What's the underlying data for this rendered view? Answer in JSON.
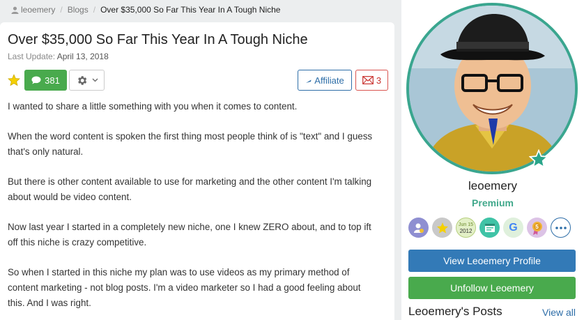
{
  "breadcrumb": {
    "user": "leoemery",
    "section": "Blogs",
    "current": "Over $35,000 So Far This Year In A Tough Niche"
  },
  "post": {
    "title": "Over $35,000 So Far This Year In A Tough Niche",
    "last_update_label": "Last Update:",
    "last_update_date": "April 13, 2018",
    "comment_count": "381",
    "affiliate_label": "Affiliate",
    "message_count": "3",
    "paragraphs": [
      "I wanted to share a little something with you when it comes to content.",
      "When the word content is spoken the first thing most people think of is \"text\" and I guess that's only natural.",
      "But there is other content available to use for marketing and the other content I'm talking about would be video content.",
      "Now last year I started in a completely new niche, one I knew ZERO about, and to top ift off this niche is crazy competitive.",
      "So when I started in this niche my plan was to use videos as my primary method of content marketing - not blog posts. I'm a video marketer so I had a good feeling about this. And I was right."
    ]
  },
  "icons": {
    "breadcrumb_user": "user-icon",
    "favorite": "star-icon",
    "comments": "comment-icon",
    "settings": "gear-icon",
    "affiliate": "link-icon",
    "message": "envelope-icon",
    "more": "more-icon"
  },
  "profile": {
    "username": "leoemery",
    "membership": "Premium",
    "badge_date_month": "Jun 15",
    "badge_date_year": "2012",
    "badge_g": "G",
    "badge_five": "5",
    "view_profile_label": "View Leoemery Profile",
    "unfollow_label": "Unfollow Leoemery",
    "posts_title": "Leoemery's Posts",
    "view_all_label": "View all"
  },
  "colors": {
    "primary_blue": "#337ab7",
    "success_green": "#49aa4d",
    "premium_teal": "#41a88b",
    "danger_red": "#d9534f"
  }
}
